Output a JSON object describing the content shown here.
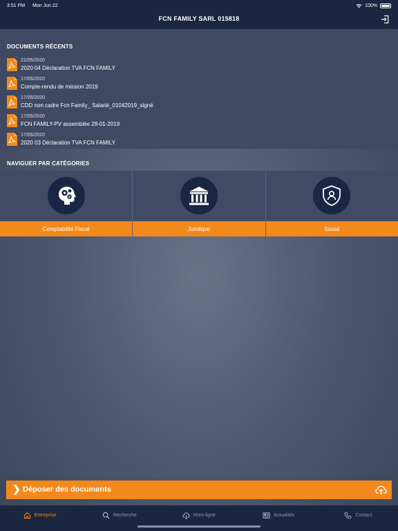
{
  "status_bar": {
    "time": "3:51 PM",
    "date": "Mon Jun 22",
    "battery": "100%"
  },
  "header": {
    "title": "FCN FAMILY SARL 015818",
    "logout_icon": "logout-icon"
  },
  "recent_documents": {
    "title": "DOCUMENTS RÉCENTS",
    "items": [
      {
        "date": "21/05/2020",
        "name": "2020 04 Déclaration TVA FCN FAMILY"
      },
      {
        "date": "17/05/2020",
        "name": "Compte-rendu de mission 2019"
      },
      {
        "date": "17/05/2020",
        "name": "CDD non cadre Fcn Family_ Salarié_01042019_signé"
      },
      {
        "date": "17/05/2020",
        "name": "FCN FAMILY-PV assemblée 28-01-2019"
      },
      {
        "date": "17/05/2020",
        "name": "2020 03 Déclaration TVA FCN FAMILY"
      }
    ]
  },
  "categories": {
    "title": "NAVIGUER PAR CATÉGORIES",
    "items": [
      {
        "label": "Comptabilité Fiscal",
        "icon": "head-gears-icon"
      },
      {
        "label": "Juridique",
        "icon": "courthouse-icon"
      },
      {
        "label": "Social",
        "icon": "shield-person-icon"
      }
    ]
  },
  "deposit": {
    "chevron": "❯",
    "label": "Déposer des documents",
    "icon": "cloud-upload-icon"
  },
  "tabbar": {
    "items": [
      {
        "label": "Entreprise",
        "icon": "home-icon",
        "active": true
      },
      {
        "label": "Recherche",
        "icon": "search-icon",
        "active": false
      },
      {
        "label": "Hors-ligne",
        "icon": "cloud-download-icon",
        "active": false
      },
      {
        "label": "Actualités",
        "icon": "news-icon",
        "active": false
      },
      {
        "label": "Contact",
        "icon": "phone-icon",
        "active": false
      }
    ]
  },
  "colors": {
    "accent": "#f3891b",
    "navy": "#1b2640",
    "panel": "#3f4962"
  }
}
